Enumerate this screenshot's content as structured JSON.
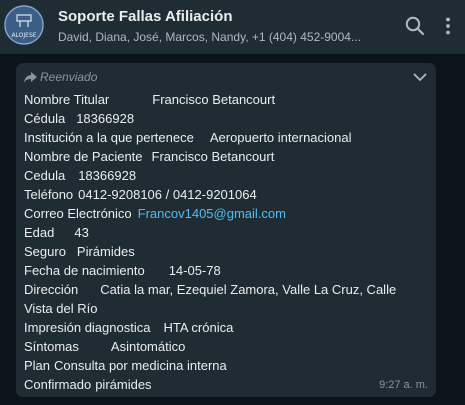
{
  "header": {
    "title": "Soporte Fallas Afiliación",
    "participants": "David, Diana, José, Marcos, Nandy, +1 (404) 452-9004...",
    "avatar_text": "ALOJESE"
  },
  "message": {
    "forwarded_label": "Reenviado",
    "time": "9:27 a. m.",
    "lines": [
      {
        "k": "Nombre Titular",
        "v": "Francisco Betancourt"
      },
      {
        "k": "Cédula",
        "v": "18366928"
      },
      {
        "k": "Institución a la que pertenece",
        "v": "Aeropuerto internacional"
      },
      {
        "k": "Nombre de Paciente",
        "v": "Francisco Betancourt"
      },
      {
        "k": "Cedula",
        "v": "18366928"
      },
      {
        "k": "Teléfono",
        "v": "0412-9208106 / 0412-9201064"
      },
      {
        "k": "Correo Electrónico",
        "v": "Francov1405@gmail.com"
      },
      {
        "k": "Edad",
        "v": "43"
      },
      {
        "k": "Seguro",
        "v": "Pirámides"
      },
      {
        "k": "Fecha de nacimiento",
        "v": "14-05-78"
      },
      {
        "k": "Dirección",
        "v": "Catia la mar, Ezequiel Zamora, Valle La Cruz, Calle Vista del Río"
      },
      {
        "k": "Impresión diagnostica",
        "v": "HTA crónica"
      },
      {
        "k": "Síntomas",
        "v": "Asintomático"
      },
      {
        "k": "Plan",
        "v": "Consulta por medicina interna"
      },
      {
        "k": "Confirmado",
        "v": "pirámides"
      }
    ]
  },
  "icons": {
    "search": "search-icon",
    "menu": "more-vertical-icon",
    "forward": "forward-icon",
    "chevron": "chevron-down-icon"
  },
  "colors": {
    "header_bg": "#202c33",
    "chat_bg": "#0b141a",
    "bubble_bg": "#202c33",
    "text": "#e9edef",
    "link": "#53bdeb",
    "muted": "#8696a0"
  }
}
